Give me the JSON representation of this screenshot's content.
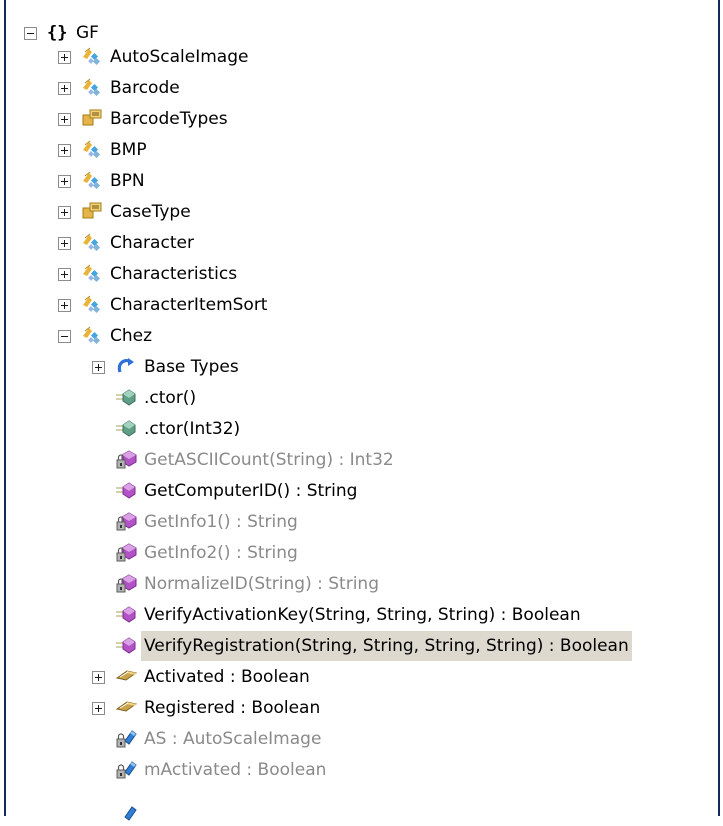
{
  "tree": {
    "root": {
      "label": "GF",
      "icon": "namespace-braces-icon",
      "expanded": true
    },
    "nodes": [
      {
        "label": "AutoScaleImage",
        "icon": "class-icon",
        "expander": "plus"
      },
      {
        "label": "Barcode",
        "icon": "class-icon",
        "expander": "plus"
      },
      {
        "label": "BarcodeTypes",
        "icon": "enum-icon",
        "expander": "plus"
      },
      {
        "label": "BMP",
        "icon": "class-icon",
        "expander": "plus"
      },
      {
        "label": "BPN",
        "icon": "class-icon",
        "expander": "plus"
      },
      {
        "label": "CaseType",
        "icon": "enum-icon",
        "expander": "plus"
      },
      {
        "label": "Character",
        "icon": "class-icon",
        "expander": "plus"
      },
      {
        "label": "Characteristics",
        "icon": "class-icon",
        "expander": "plus"
      },
      {
        "label": "CharacterItemSort",
        "icon": "class-icon",
        "expander": "plus"
      },
      {
        "label": "Chez",
        "icon": "class-icon",
        "expander": "minus"
      }
    ],
    "chez_children": [
      {
        "label": "Base Types",
        "icon": "base-types-icon",
        "expander": "plus",
        "gray": false
      },
      {
        "label": ".ctor()",
        "icon": "public-constructor-icon",
        "gray": false
      },
      {
        "label": ".ctor(Int32)",
        "icon": "public-constructor-icon",
        "gray": false
      },
      {
        "label": "GetASCIICount(String) : Int32",
        "icon": "private-method-icon",
        "gray": true
      },
      {
        "label": "GetComputerID() : String",
        "icon": "public-method-icon",
        "gray": false
      },
      {
        "label": "GetInfo1() : String",
        "icon": "private-method-icon",
        "gray": true
      },
      {
        "label": "GetInfo2() : String",
        "icon": "private-method-icon",
        "gray": true
      },
      {
        "label": "NormalizeID(String) : String",
        "icon": "private-method-icon",
        "gray": true
      },
      {
        "label": "VerifyActivationKey(String, String, String) : Boolean",
        "icon": "public-method-icon",
        "gray": false
      },
      {
        "label": "VerifyRegistration(String, String, String, String) : Boolean",
        "icon": "public-method-icon",
        "gray": false,
        "selected": true
      },
      {
        "label": "Activated : Boolean",
        "icon": "property-icon",
        "expander": "plus",
        "gray": false
      },
      {
        "label": "Registered : Boolean",
        "icon": "property-icon",
        "expander": "plus",
        "gray": false
      },
      {
        "label": "AS : AutoScaleImage",
        "icon": "private-field-icon",
        "gray": true
      },
      {
        "label": "mActivated : Boolean",
        "icon": "private-field-icon",
        "gray": true
      }
    ]
  },
  "colors": {
    "selection": "#ded9cf",
    "frame_border": "#14275a",
    "grayed_text": "#8a8a8a"
  }
}
